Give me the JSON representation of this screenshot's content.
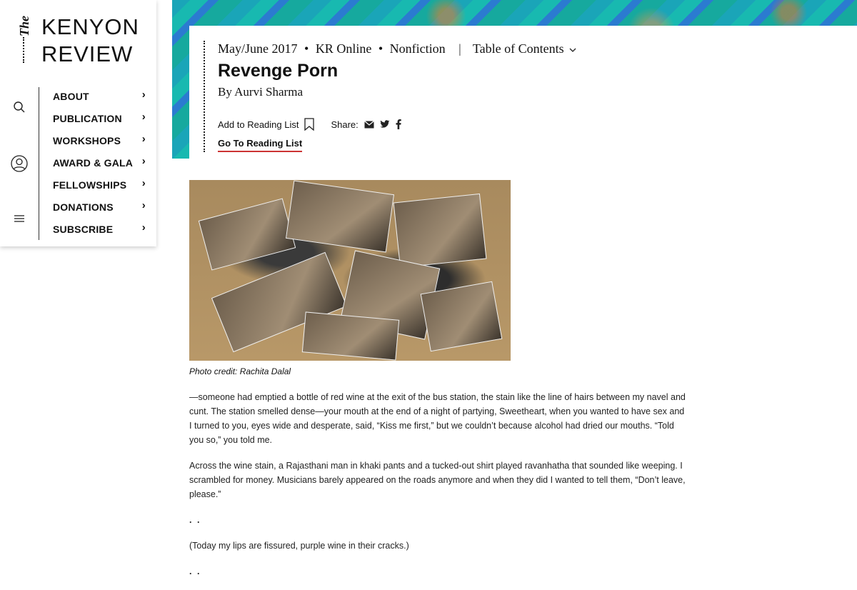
{
  "brand": {
    "the": "The",
    "line1": "KENYON",
    "line2": "REVIEW"
  },
  "rail_icons": [
    "search-icon",
    "user-icon",
    "menu-icon"
  ],
  "menu": [
    {
      "label": "ABOUT"
    },
    {
      "label": "PUBLICATION"
    },
    {
      "label": "WORKSHOPS"
    },
    {
      "label": "AWARD & GALA"
    },
    {
      "label": "FELLOWSHIPS"
    },
    {
      "label": "DONATIONS"
    },
    {
      "label": "SUBSCRIBE"
    }
  ],
  "article": {
    "issue": "May/June 2017",
    "section": "KR Online",
    "category": "Nonfiction",
    "bullet": "•",
    "pipe": "|",
    "toc": "Table of Contents",
    "title": "Revenge Porn",
    "byline": "By Aurvi Sharma",
    "reading_list": "Add to Reading List",
    "share": "Share:",
    "go_to_list": "Go To Reading List",
    "photo_caption": "Photo credit: Rachita Dalal",
    "paragraphs": [
      "—someone had emptied a bottle of red wine at the exit of the bus station, the stain like the line of hairs between my navel and cunt. The station smelled dense—your mouth at the end of a night of partying, Sweetheart, when you wanted to have sex and I turned to you, eyes wide and desperate, said, “Kiss me first,” but we couldn’t because alcohol had dried our mouths. “Told you so,” you told me.",
      "Across the wine stain, a Rajasthani man in khaki pants and a tucked-out shirt played ravanhatha that sounded like weeping. I scrambled for money. Musicians barely appeared on the roads anymore and when they did I wanted to tell them, “Don’t leave, please.”",
      "(Today my lips are fissured, purple wine in their cracks.)"
    ],
    "divider": ". ."
  },
  "colors": {
    "accent_underline": "#cc3333",
    "banner_teal": "#1aa5b8"
  }
}
